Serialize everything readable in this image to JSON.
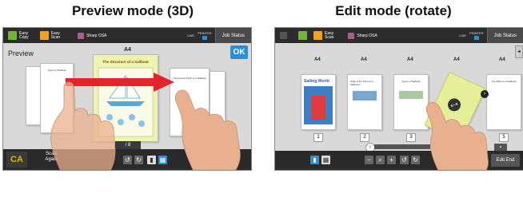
{
  "captions": {
    "left": "Preview mode (3D)",
    "right": "Edit mode (rotate)"
  },
  "topbar": {
    "easy_copy": "Easy\nCopy",
    "easy_scan": "Easy\nScan",
    "sharp_osa": "Sharp OSA",
    "line": "LINE",
    "printer": "PRINTER",
    "job_status": "Job Status"
  },
  "preview": {
    "title": "Preview",
    "ok": "OK",
    "page_size": "A4",
    "doc_title": "The Structure of a Sailboat",
    "left_doc_title": "Types of Sailboat",
    "right_doc_title": "Component Parts of a Sailboat",
    "page_counter": "/ 8",
    "ca": "CA",
    "scan_again": "Scan\nAgain"
  },
  "edit": {
    "sizes": [
      "A4",
      "A4",
      "A4",
      "A4",
      "A4"
    ],
    "page_numbers": [
      "1",
      "2",
      "3",
      "5"
    ],
    "edit_end": "Edit End",
    "magazine_title": "Sailing World",
    "page2_title": "What is the Point of a Sailboat?",
    "page3_title": "Types of Sailboat",
    "page5_title": "The Parts of a Sailboat"
  },
  "colors": {
    "ok": "#2a8fd6",
    "ca": "#e8b300",
    "arrow": "#e4232a",
    "highlight": "#e6ee9a"
  }
}
